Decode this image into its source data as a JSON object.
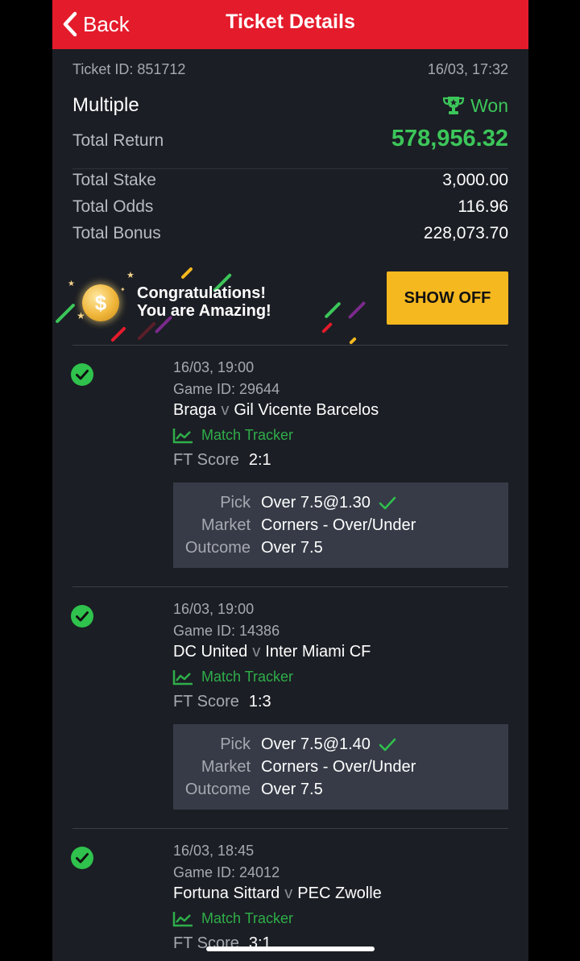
{
  "header": {
    "back_label": "Back",
    "title": "Ticket Details"
  },
  "ticket": {
    "id_text": "Ticket ID: 851712",
    "datetime": "16/03, 17:32",
    "type": "Multiple",
    "status": "Won",
    "total_return_label": "Total Return",
    "total_return": "578,956.32",
    "total_stake_label": "Total Stake",
    "total_stake": "3,000.00",
    "total_odds_label": "Total Odds",
    "total_odds": "116.96",
    "total_bonus_label": "Total Bonus",
    "total_bonus": "228,073.70"
  },
  "banner": {
    "line1": "Congratulations!",
    "line2": "You are Amazing!",
    "button": "SHOW OFF",
    "coin_symbol": "$"
  },
  "labels": {
    "match_tracker": "Match Tracker",
    "ft_score": "FT Score",
    "pick": "Pick",
    "market": "Market",
    "outcome": "Outcome",
    "versus": "v"
  },
  "legs": [
    {
      "datetime": "16/03, 19:00",
      "game_id": "Game ID: 29644",
      "home": "Braga",
      "away": "Gil Vicente Barcelos",
      "ft_score": "2:1",
      "pick": "Over 7.5@1.30",
      "market": "Corners - Over/Under",
      "outcome": "Over 7.5"
    },
    {
      "datetime": "16/03, 19:00",
      "game_id": "Game ID: 14386",
      "home": "DC United",
      "away": "Inter Miami CF",
      "ft_score": "1:3",
      "pick": "Over 7.5@1.40",
      "market": "Corners - Over/Under",
      "outcome": "Over 7.5"
    },
    {
      "datetime": "16/03, 18:45",
      "game_id": "Game ID: 24012",
      "home": "Fortuna Sittard",
      "away": "PEC Zwolle",
      "ft_score": "3:1"
    }
  ],
  "colors": {
    "header_red": "#e41b2b",
    "won_green": "#3cc65a",
    "button_yellow": "#f5b81f",
    "panel_bg": "#1b1e24",
    "pick_box_bg": "#363b47"
  },
  "icons": [
    "chevron-left-icon",
    "trophy-icon",
    "coin-icon",
    "check-circle-icon",
    "chart-icon",
    "checkmark-icon"
  ]
}
